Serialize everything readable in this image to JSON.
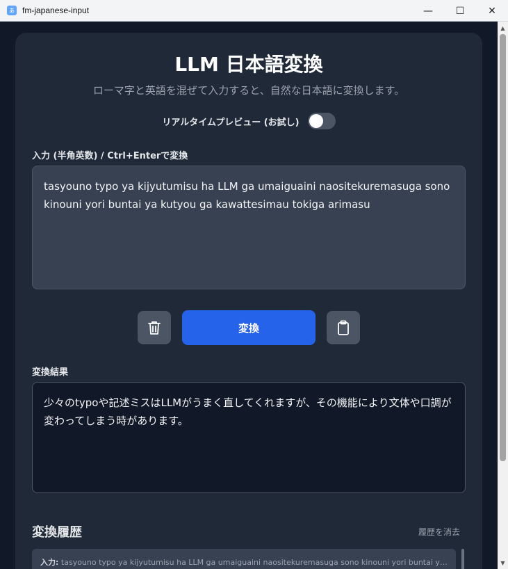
{
  "window": {
    "title": "fm-japanese-input",
    "icon": "app-icon",
    "controls": {
      "minimize": "—",
      "maximize": "☐",
      "close": "✕"
    }
  },
  "header": {
    "title": "LLM 日本語変換",
    "subtitle": "ローマ字と英語を混ぜて入力すると、自然な日本語に変換します。"
  },
  "preview": {
    "label": "リアルタイムプレビュー (お試し)",
    "enabled": false
  },
  "input": {
    "label": "入力 (半角英数) / Ctrl+Enterで変換",
    "value": "tasyouno typo ya kijyutumisu ha LLM ga umaiguaini naositekuremasuga sono kinouni yori buntai ya kutyou ga kawattesimau tokiga arimasu"
  },
  "actions": {
    "convert_label": "変換",
    "clear_icon": "trash-icon",
    "copy_icon": "clipboard-icon"
  },
  "output": {
    "label": "変換結果",
    "value": "少々のtypoや記述ミスはLLMがうまく直してくれますが、その機能により文体や口調が変わってしまう時があります。"
  },
  "history": {
    "title": "変換履歴",
    "clear_label": "履歴を消去",
    "items": [
      {
        "prefix": "入力:",
        "text": "tasyouno typo ya kijyutumisu ha LLM ga umaiguaini naositekuremasuga sono kinouni yori buntai ya kutyou ga kawattesimau tokiga arimasu"
      }
    ]
  },
  "colors": {
    "accent": "#2563eb",
    "card": "#1f2937",
    "background": "#111827"
  }
}
